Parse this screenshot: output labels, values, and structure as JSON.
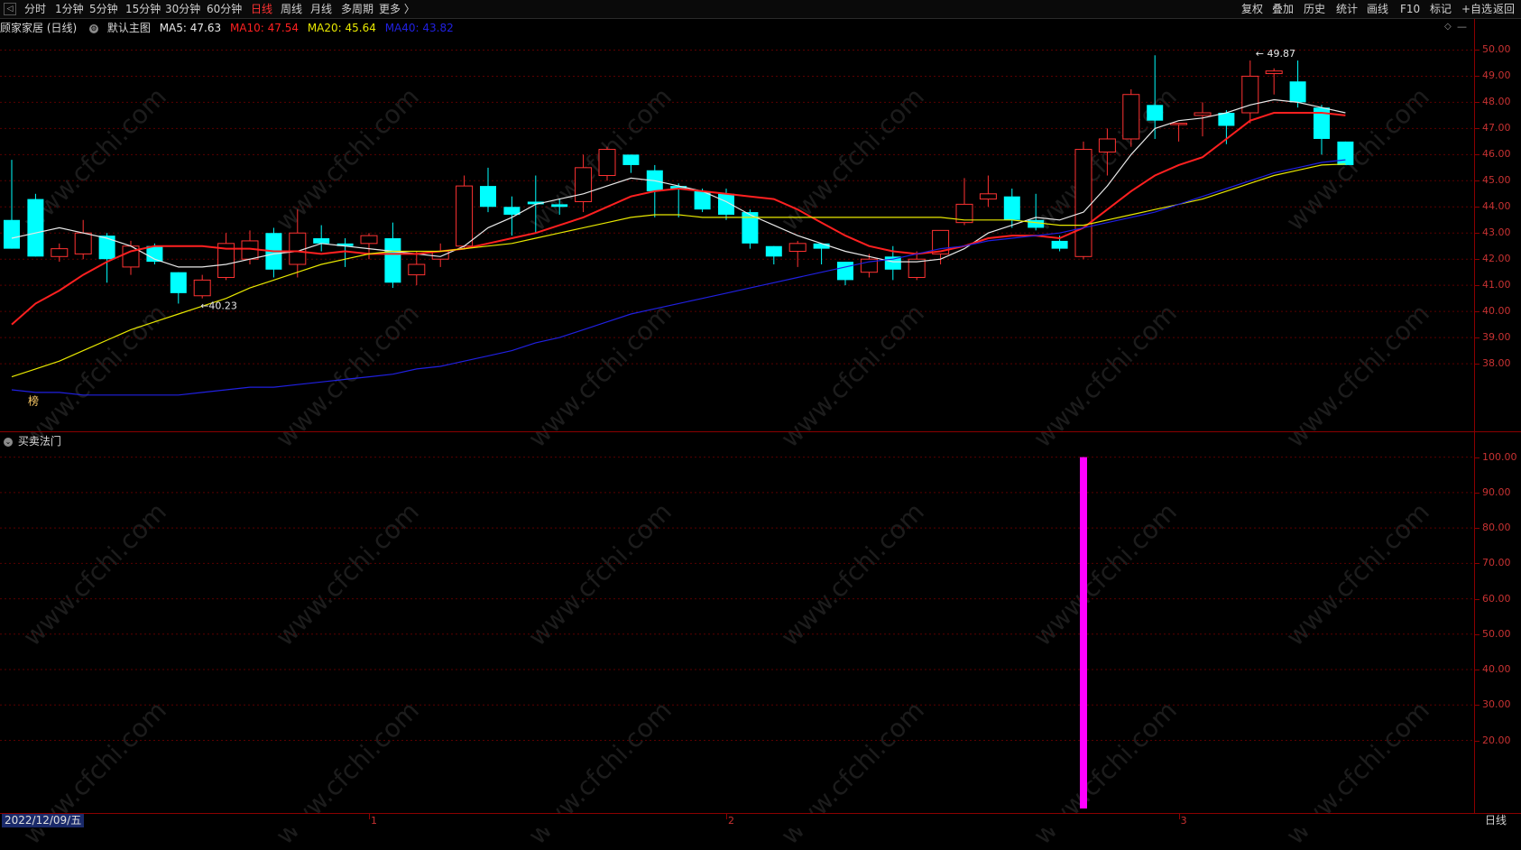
{
  "toolbar": {
    "left_items": [
      "分时",
      "1分钟",
      "5分钟",
      "15分钟",
      "30分钟",
      "60分钟",
      "日线",
      "周线",
      "月线",
      "多周期",
      "更多 〉"
    ],
    "active_item": "日线",
    "right_items": [
      "复权",
      "叠加",
      "历史",
      "统计",
      "画线",
      "F10",
      "标记",
      "+自选",
      "返回"
    ]
  },
  "main_legend": {
    "title": "顾家家居 (日线)",
    "indicator_name": "默认主图",
    "ma5": "MA5: 47.63",
    "ma10": "MA10: 47.54",
    "ma20": "MA20: 45.64",
    "ma40": "MA40: 43.82",
    "colors": {
      "ma5": "#e8e8e8",
      "ma10": "#ff2020",
      "ma20": "#e8e800",
      "ma40": "#2020e0"
    }
  },
  "sub_legend": {
    "title": "买卖法门"
  },
  "annotations": {
    "high": "49.87",
    "low": "40.23",
    "marker": "榜"
  },
  "date_bar": {
    "selected_date": "2022/12/09/五",
    "period": "日线",
    "month_marks": [
      "1",
      "2",
      "3"
    ]
  },
  "watermark": "www.cfchi.com",
  "chart_data": [
    {
      "type": "candlestick",
      "title": "顾家家居 (日线)",
      "ylim": [
        36.0,
        50.5
      ],
      "yticks": [
        38.0,
        39.0,
        40.0,
        41.0,
        42.0,
        43.0,
        44.0,
        45.0,
        46.0,
        47.0,
        48.0,
        49.0,
        50.0
      ],
      "up_color": "#ff3232",
      "down_color": "#00ffff",
      "candles": [
        [
          43.5,
          45.8,
          42.4,
          42.4
        ],
        [
          44.3,
          44.5,
          42.1,
          42.1
        ],
        [
          42.1,
          42.6,
          41.9,
          42.4
        ],
        [
          42.2,
          43.5,
          42.0,
          43.0
        ],
        [
          42.9,
          43.0,
          41.1,
          42.0
        ],
        [
          41.7,
          42.7,
          41.4,
          42.5
        ],
        [
          42.5,
          42.6,
          41.8,
          41.9
        ],
        [
          41.5,
          41.5,
          40.3,
          40.7
        ],
        [
          40.6,
          41.4,
          40.5,
          41.2
        ],
        [
          41.3,
          43.0,
          41.2,
          42.6
        ],
        [
          42.0,
          43.1,
          41.8,
          42.7
        ],
        [
          43.0,
          43.2,
          41.3,
          41.6
        ],
        [
          41.8,
          43.9,
          41.3,
          43.0
        ],
        [
          42.8,
          43.3,
          42.3,
          42.6
        ],
        [
          42.6,
          42.8,
          41.7,
          42.5
        ],
        [
          42.6,
          43.0,
          42.0,
          42.9
        ],
        [
          42.8,
          43.4,
          40.9,
          41.1
        ],
        [
          41.4,
          42.3,
          41.0,
          41.8
        ],
        [
          42.0,
          42.6,
          41.7,
          42.3
        ],
        [
          42.5,
          45.2,
          42.4,
          44.8
        ],
        [
          44.8,
          45.5,
          43.8,
          44.0
        ],
        [
          44.0,
          44.4,
          42.9,
          43.7
        ],
        [
          44.2,
          45.2,
          43.0,
          44.1
        ],
        [
          44.1,
          44.3,
          43.7,
          44.0
        ],
        [
          44.2,
          46.0,
          43.8,
          45.5
        ],
        [
          45.2,
          46.3,
          45.0,
          46.2
        ],
        [
          46.0,
          46.0,
          45.3,
          45.6
        ],
        [
          45.4,
          45.6,
          43.6,
          44.6
        ],
        [
          44.8,
          44.9,
          43.6,
          44.7
        ],
        [
          44.6,
          44.7,
          43.8,
          43.9
        ],
        [
          44.5,
          44.7,
          43.5,
          43.7
        ],
        [
          43.8,
          43.9,
          42.4,
          42.6
        ],
        [
          42.5,
          42.5,
          41.8,
          42.1
        ],
        [
          42.3,
          42.7,
          41.7,
          42.6
        ],
        [
          42.6,
          42.6,
          41.8,
          42.4
        ],
        [
          41.9,
          41.9,
          41.0,
          41.2
        ],
        [
          41.5,
          42.2,
          41.3,
          42.0
        ],
        [
          42.1,
          42.5,
          41.2,
          41.6
        ],
        [
          41.3,
          42.3,
          41.2,
          42.0
        ],
        [
          42.2,
          43.1,
          41.8,
          43.1
        ],
        [
          43.4,
          45.1,
          43.3,
          44.1
        ],
        [
          44.3,
          45.2,
          44.0,
          44.5
        ],
        [
          44.4,
          44.7,
          43.2,
          43.5
        ],
        [
          43.5,
          44.5,
          43.1,
          43.2
        ],
        [
          42.7,
          42.9,
          42.3,
          42.4
        ],
        [
          42.1,
          46.5,
          42.0,
          46.2
        ],
        [
          46.1,
          47.0,
          45.2,
          46.6
        ],
        [
          46.6,
          48.5,
          46.3,
          48.3
        ],
        [
          47.9,
          49.8,
          46.6,
          47.3
        ],
        [
          47.2,
          47.2,
          46.5,
          47.2
        ],
        [
          47.5,
          48.0,
          46.7,
          47.6
        ],
        [
          47.6,
          47.7,
          46.4,
          47.1
        ],
        [
          47.6,
          49.6,
          47.2,
          49.0
        ],
        [
          49.1,
          49.3,
          48.3,
          49.2
        ],
        [
          48.8,
          49.6,
          47.8,
          48.0
        ],
        [
          47.8,
          47.9,
          46.0,
          46.6
        ],
        [
          46.5,
          46.5,
          45.6,
          45.6
        ]
      ],
      "series": [
        {
          "name": "MA5",
          "color": "#e8e8e8",
          "values": [
            42.8,
            43.0,
            43.2,
            43.0,
            42.8,
            42.5,
            42.0,
            41.7,
            41.7,
            41.8,
            42.0,
            42.2,
            42.3,
            42.6,
            42.5,
            42.4,
            42.3,
            42.2,
            42.1,
            42.5,
            43.2,
            43.6,
            44.1,
            44.3,
            44.5,
            44.8,
            45.1,
            45.0,
            44.8,
            44.6,
            44.2,
            43.7,
            43.3,
            42.9,
            42.6,
            42.3,
            42.1,
            41.9,
            41.9,
            42.0,
            42.4,
            43.0,
            43.3,
            43.6,
            43.5,
            43.8,
            44.8,
            46.0,
            47.0,
            47.3,
            47.4,
            47.6,
            47.9,
            48.1,
            48.0,
            47.8,
            47.6
          ]
        },
        {
          "name": "MA10",
          "color": "#ff2020",
          "values": [
            39.5,
            40.3,
            40.8,
            41.4,
            41.9,
            42.3,
            42.5,
            42.5,
            42.5,
            42.4,
            42.4,
            42.3,
            42.3,
            42.2,
            42.3,
            42.2,
            42.2,
            42.2,
            42.3,
            42.4,
            42.6,
            42.8,
            43.0,
            43.3,
            43.6,
            44.0,
            44.4,
            44.6,
            44.7,
            44.6,
            44.5,
            44.4,
            44.3,
            43.9,
            43.4,
            42.9,
            42.5,
            42.3,
            42.2,
            42.3,
            42.5,
            42.8,
            42.9,
            42.9,
            42.8,
            43.2,
            43.9,
            44.6,
            45.2,
            45.6,
            45.9,
            46.6,
            47.3,
            47.6,
            47.6,
            47.6,
            47.5
          ]
        },
        {
          "name": "MA20",
          "color": "#e8e800",
          "values": [
            37.5,
            37.8,
            38.1,
            38.5,
            38.9,
            39.3,
            39.6,
            39.9,
            40.2,
            40.5,
            40.9,
            41.2,
            41.5,
            41.8,
            42.0,
            42.2,
            42.3,
            42.3,
            42.3,
            42.4,
            42.5,
            42.6,
            42.8,
            43.0,
            43.2,
            43.4,
            43.6,
            43.7,
            43.7,
            43.6,
            43.6,
            43.6,
            43.6,
            43.6,
            43.6,
            43.6,
            43.6,
            43.6,
            43.6,
            43.6,
            43.5,
            43.5,
            43.5,
            43.4,
            43.3,
            43.3,
            43.5,
            43.7,
            43.9,
            44.1,
            44.3,
            44.6,
            44.9,
            45.2,
            45.4,
            45.6,
            45.64
          ]
        },
        {
          "name": "MA40",
          "color": "#2020e0",
          "values": [
            37.0,
            36.9,
            36.9,
            36.8,
            36.8,
            36.8,
            36.8,
            36.8,
            36.9,
            37.0,
            37.1,
            37.1,
            37.2,
            37.3,
            37.4,
            37.5,
            37.6,
            37.8,
            37.9,
            38.1,
            38.3,
            38.5,
            38.8,
            39.0,
            39.3,
            39.6,
            39.9,
            40.1,
            40.3,
            40.5,
            40.7,
            40.9,
            41.1,
            41.3,
            41.5,
            41.7,
            41.9,
            42.0,
            42.2,
            42.4,
            42.5,
            42.7,
            42.8,
            42.9,
            43.0,
            43.2,
            43.4,
            43.6,
            43.8,
            44.1,
            44.4,
            44.7,
            45.0,
            45.3,
            45.5,
            45.7,
            45.8
          ]
        }
      ]
    },
    {
      "type": "bar",
      "title": "买卖法门",
      "ylim": [
        0,
        105
      ],
      "yticks": [
        20.0,
        30.0,
        40.0,
        50.0,
        60.0,
        70.0,
        80.0,
        90.0,
        100.0
      ],
      "color": "#ff00ff",
      "bars": [
        {
          "index": 45,
          "value": 100.0
        }
      ]
    }
  ]
}
